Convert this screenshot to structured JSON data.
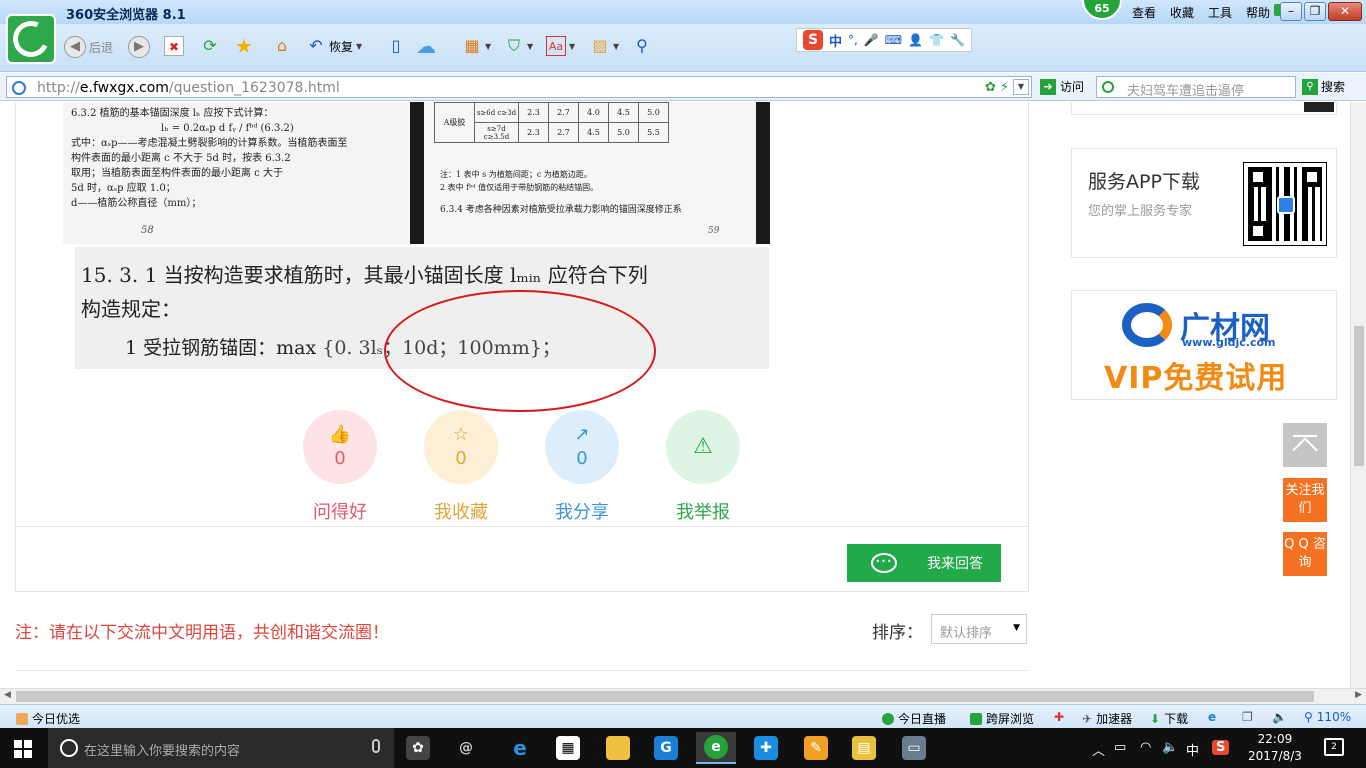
{
  "browser": {
    "app_name": "360安全浏览器 8.1",
    "badge": "65",
    "menu": [
      "查看",
      "收藏",
      "工具",
      "帮助"
    ],
    "back_label": "后退",
    "restore_label": "恢复",
    "url_domain": "e.fwxgx.com",
    "url_prefix": "http://",
    "url_path": "/question_1623078.html",
    "visit_label": "访问",
    "search_placeholder": "夫妇驾车遭追击逼停",
    "search_button": "搜索",
    "ime": {
      "lang": "中",
      "punct": "°,"
    }
  },
  "book": {
    "left_lines": [
      "6.3.2  植筋的基本锚固深度 lₕ 应按下式计算：",
      "lₕ = 0.2αₛp d fᵧ / fᵇᵈ          (6.3.2)",
      "式中：αₛp——考虑混凝土劈裂影响的计算系数。当植筋表面至",
      "    构件表面的最小距离 c 不大于 5d 时，按表 6.3.2",
      "    取用；当植筋表面至构件表面的最小距离 c 大于",
      "    5d 时，αₛp 应取 1.0；",
      "d——植筋公称直径（mm）；"
    ],
    "left_page": "58",
    "table_label": "A级胶",
    "table_rows": [
      [
        "s≥6d c≥3d",
        "2.3",
        "2.7",
        "4.0",
        "4.5",
        "5.0"
      ],
      [
        "s≥7d c≥3.5d",
        "2.3",
        "2.7",
        "4.5",
        "5.0",
        "5.5"
      ]
    ],
    "notes": [
      "注：1  表中 s 为植筋间距；c 为植筋边距。",
      "    2  表中 fᵇᵈ 值仅适用于带肋钢筋的粘结锚固。"
    ],
    "section": "6.3.4  考虑各种因素对植筋受拉承载力影响的锚固深度修正系",
    "right_page": "59"
  },
  "clause": {
    "line1": "15. 3. 1   当按构造要求植筋时，其最小锚固长度 lₘᵢₙ 应符合下列",
    "line2": "构造规定：",
    "line3_prefix": "1   受拉钢筋锚固：max",
    "line3_formula": "{0. 3lₛ；10d；100mm}；"
  },
  "actions": [
    {
      "icon": "👍",
      "count": "0",
      "label": "问得好"
    },
    {
      "icon": "☆",
      "count": "0",
      "label": "我收藏"
    },
    {
      "icon": "↗",
      "count": "0",
      "label": "我分享"
    },
    {
      "icon": "⚠",
      "count": "",
      "label": "我举报"
    }
  ],
  "answer_button": "我来回答",
  "notice": "注：请在以下交流中文明用语，共创和谐交流圈！",
  "sort": {
    "label": "排序：",
    "value": "默认排序"
  },
  "sidebar": {
    "app_title": "服务APP下载",
    "app_sub": "您的掌上服务专家",
    "ad_brand": "广材网",
    "ad_url": "www.gldjc.com",
    "ad_vip": "VIP免费试用",
    "follow": "关注我们",
    "qq": "Q Q 咨询"
  },
  "statusbar": {
    "today": "今日优选",
    "live": "今日直播",
    "cross": "跨屏浏览",
    "accel": "加速器",
    "download": "下载",
    "zoom": "110%"
  },
  "taskbar": {
    "search_placeholder": "在这里输入你要搜索的内容",
    "ime": "中",
    "time": "22:09",
    "date": "2017/8/3",
    "notifications": "2"
  },
  "colors": {
    "accent_green": "#22a94a",
    "notice_red": "#e0443c",
    "ellipse_red": "#d7191c",
    "orange": "#f37121"
  }
}
